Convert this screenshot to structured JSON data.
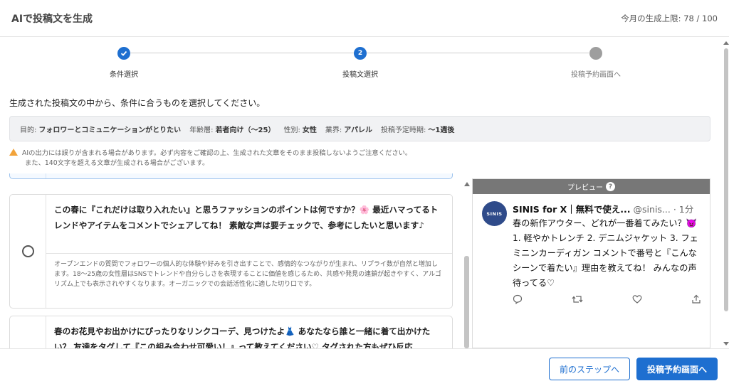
{
  "header": {
    "title": "AIで投稿文を生成",
    "limit_text": "今月の生成上限: 78 / 100"
  },
  "stepper": {
    "steps": [
      {
        "label": "条件選択",
        "status": "done"
      },
      {
        "label": "投稿文選択",
        "number": "2",
        "status": "current"
      },
      {
        "label": "投稿予約画面へ",
        "status": "pending"
      }
    ]
  },
  "instruction": "生成された投稿文の中から、条件に合うものを選択してください。",
  "conditions": [
    {
      "key": "目的:",
      "value": "フォロワーとコミュニケーションがとりたい"
    },
    {
      "key": "年齢層:",
      "value": "若者向け（〜25）"
    },
    {
      "key": "性別:",
      "value": "女性"
    },
    {
      "key": "業界:",
      "value": "アパレル"
    },
    {
      "key": "投稿予定時期:",
      "value": "〜1週後"
    }
  ],
  "warning": {
    "line1": "AIの出力には誤りが含まれる場合があります。必ず内容をご確認の上、生成された文章をそのまま投稿しないようご注意ください。",
    "line2": "また、140文字を超える文章が生成される場合がございます。"
  },
  "options": [
    {
      "text": "この春に『これだけは取り入れたい』と思うファッションのポイントは何ですか？🌸 最近ハマってるトレンドやアイテムをコメントでシェアしてね！ 素敵な声は要チェックで、参考にしたいと思います♪",
      "explanation": "オープンエンドの質問でフォロワーの個人的な体験や好みを引き出すことで、感情的なつながりが生まれ、リプライ数が自然と増加します。18〜25歳の女性層はSNSでトレンドや自分らしさを表現することに価値を感じるため、共感や発見の連鎖が起きやすく、アルゴリズム上でも表示されやすくなります。オーガニックでの会話活性化に適した切り口です。"
    },
    {
      "text": "春のお花見やお出かけにぴったりなリンクコーデ、見つけたよ👗 あなたなら誰と一緒に着て出かけたい？ 友達をタグして『この組み合わせ可愛い！』って教えてください♡ タグされた方もぜひ反応"
    }
  ],
  "preview": {
    "bar_label": "プレビュー",
    "help_icon": "?",
    "avatar_text": "SINIS",
    "name": "SINIS for X｜無料で使え...",
    "handle": "@sinis...",
    "time": "· 1分",
    "body": "春の新作アウター、どれが一番着てみたい？👿 1. 軽やかトレンチ 2. デニムジャケット 3. フェミニンカーディガン コメントで番号と『こんなシーンで着たい』理由を教えてね！ みんなの声待ってる♡"
  },
  "footer": {
    "back_label": "前のステップへ",
    "next_label": "投稿予約画面へ"
  },
  "colors": {
    "accent": "#1e6fd0",
    "step_pending": "#9e9e9e",
    "warning": "#f2a33a"
  }
}
